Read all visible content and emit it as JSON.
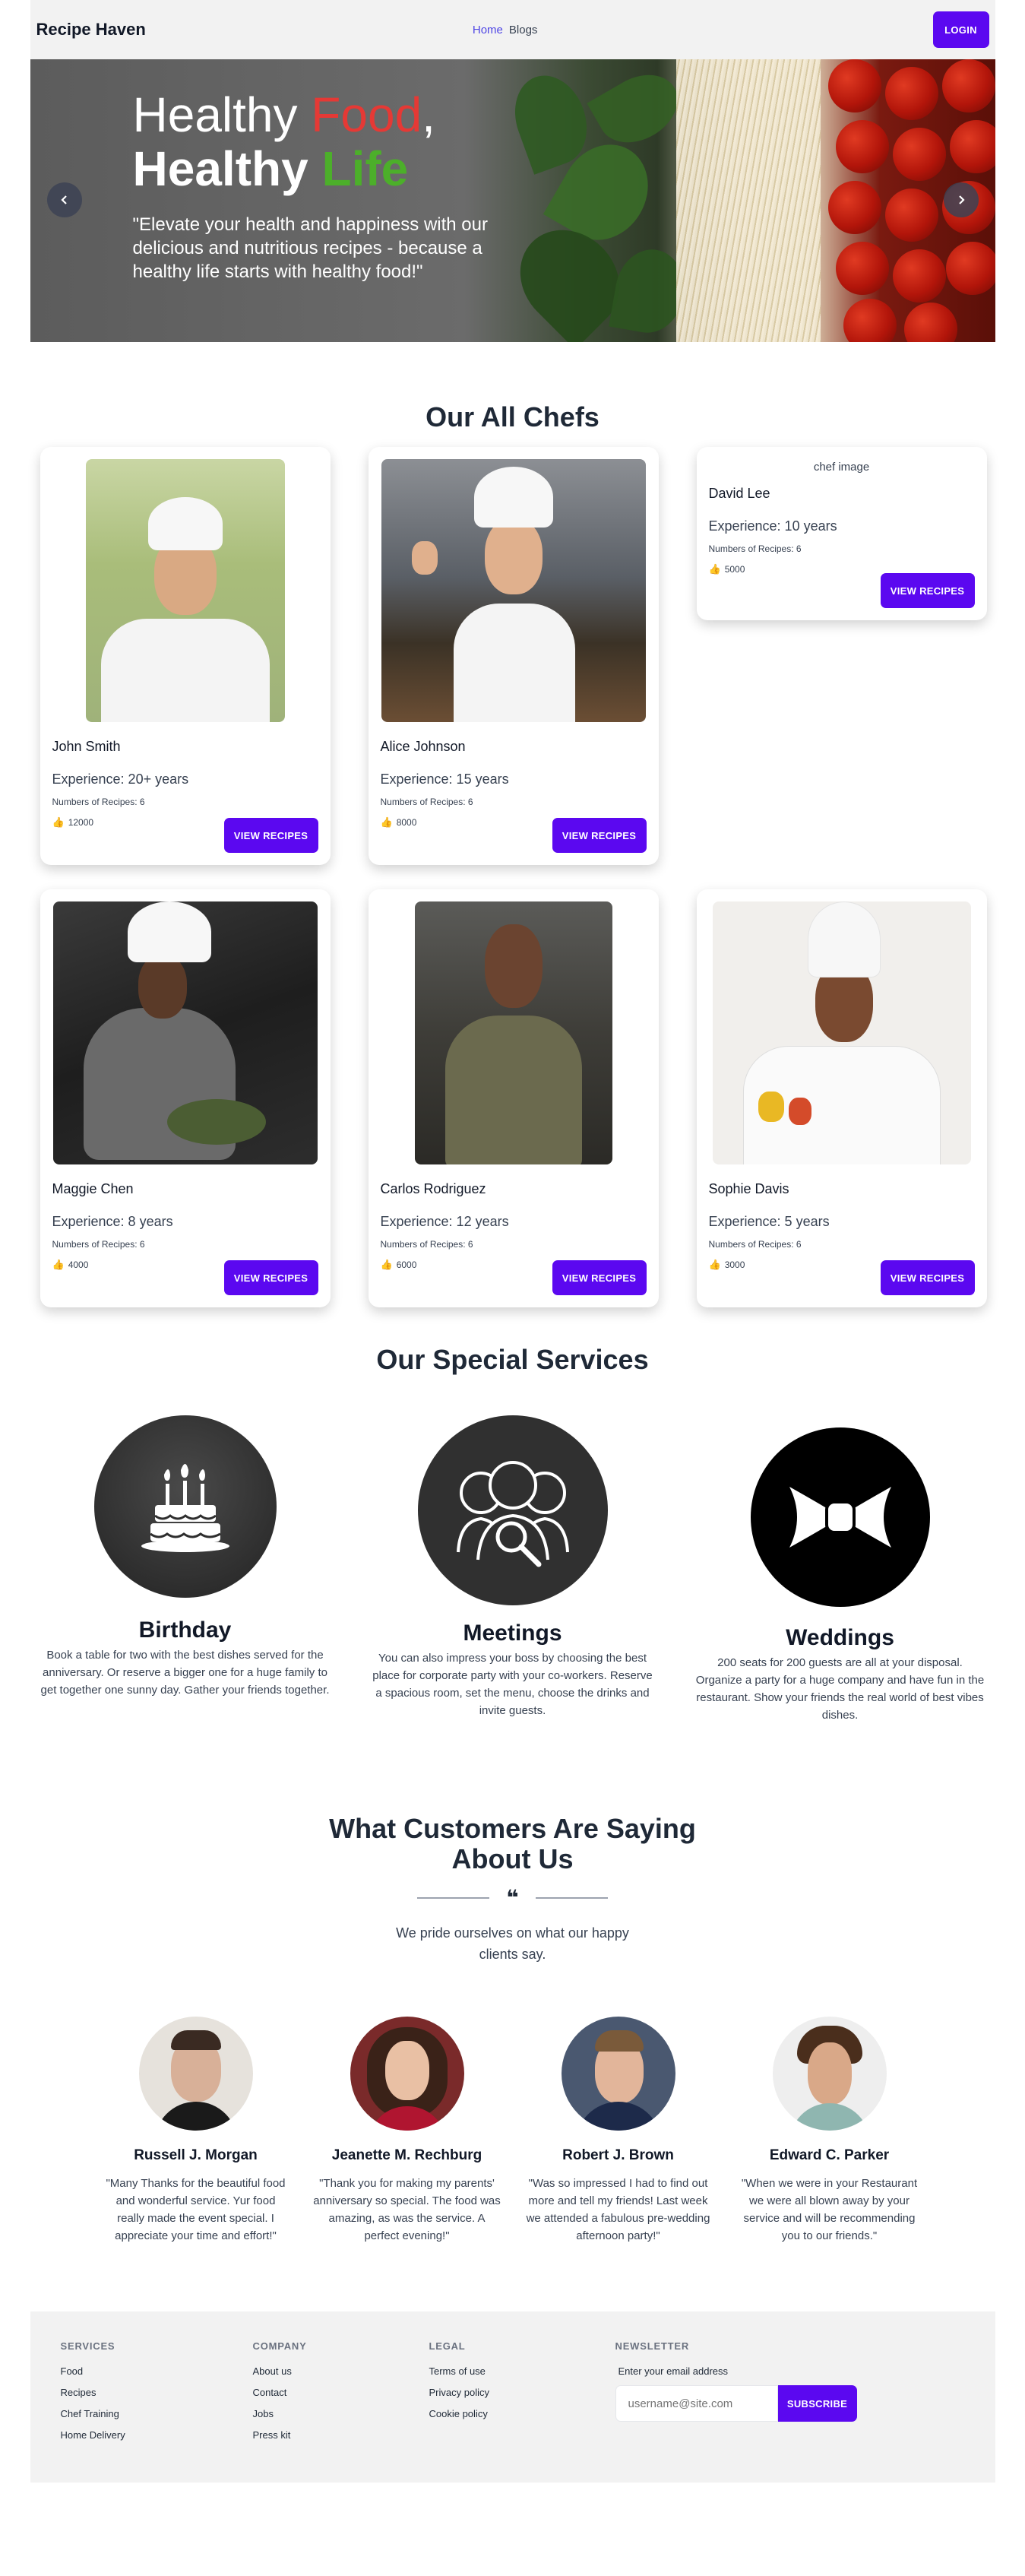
{
  "nav": {
    "brand": "Recipe Haven",
    "links": [
      "Home",
      "Blogs"
    ],
    "login": "LOGIN"
  },
  "hero": {
    "line1_a": "Healthy ",
    "line1_b": "Food",
    "line1_c": ",",
    "line2_a": "Healthy ",
    "line2_b": "Life",
    "quote": "\"Elevate your health and happiness with our delicious and nutritious recipes - because a healthy life starts with healthy food!\"",
    "prev_icon": "chevron-left-icon",
    "next_icon": "chevron-right-icon"
  },
  "chefs": {
    "title": "Our All Chefs",
    "view_label": "VIEW RECIPES",
    "broken_alt": "chef image",
    "items": [
      {
        "name": "John Smith",
        "experience": "Experience: 20+ years",
        "recipes": "Numbers of Recipes: 6",
        "likes": "12000"
      },
      {
        "name": "Alice Johnson",
        "experience": "Experience: 15 years",
        "recipes": "Numbers of Recipes: 6",
        "likes": "8000"
      },
      {
        "name": "David Lee",
        "experience": "Experience: 10 years",
        "recipes": "Numbers of Recipes: 6",
        "likes": "5000"
      },
      {
        "name": "Maggie Chen",
        "experience": "Experience: 8 years",
        "recipes": "Numbers of Recipes: 6",
        "likes": "4000"
      },
      {
        "name": "Carlos Rodriguez",
        "experience": "Experience: 12 years",
        "recipes": "Numbers of Recipes: 6",
        "likes": "6000"
      },
      {
        "name": "Sophie Davis",
        "experience": "Experience: 5 years",
        "recipes": "Numbers of Recipes: 6",
        "likes": "3000"
      }
    ]
  },
  "services": {
    "title": "Our Special Services",
    "items": [
      {
        "name": "Birthday",
        "desc": "Book a table for two with the best dishes served for the anniversary. Or reserve a bigger one for a huge family to get together one sunny day. Gather your friends together.",
        "icon": "birthday-cake-icon"
      },
      {
        "name": "Meetings",
        "desc": "You can also impress your boss by choosing the best place for corporate party with your co-workers. Reserve a spacious room, set the menu, choose the drinks and invite guests.",
        "icon": "meeting-people-icon"
      },
      {
        "name": "Weddings",
        "desc": "200 seats for 200 guests are all at your disposal. Organize a party for a huge company and have fun in the restaurant. Show your friends the real world of best vibes dishes.",
        "icon": "bow-tie-icon"
      }
    ]
  },
  "testimonials": {
    "title_line1": "What Customers Are Saying",
    "title_line2": "About Us",
    "quote_mark": "❝",
    "subtitle": "We pride ourselves on what our happy clients say.",
    "items": [
      {
        "name": "Russell J. Morgan",
        "text": "\"Many Thanks for the beautiful food and wonderful service. Yur food really made the event special. I appreciate your time and effort!\""
      },
      {
        "name": "Jeanette M. Rechburg",
        "text": "\"Thank you for making my parents' anniversary so special. The food was amazing, as was the service. A perfect evening!\""
      },
      {
        "name": "Robert J. Brown",
        "text": "\"Was so impressed I had to find out more and tell my friends! Last week we attended a fabulous pre-wedding afternoon party!\""
      },
      {
        "name": "Edward C. Parker",
        "text": "\"When we were in your Restaurant we were all blown away by your service and will be recommending you to our friends.\""
      }
    ]
  },
  "footer": {
    "services": {
      "title": "SERVICES",
      "links": [
        "Food",
        "Recipes",
        "Chef Training",
        "Home Delivery"
      ]
    },
    "company": {
      "title": "COMPANY",
      "links": [
        "About us",
        "Contact",
        "Jobs",
        "Press kit"
      ]
    },
    "legal": {
      "title": "LEGAL",
      "links": [
        "Terms of use",
        "Privacy policy",
        "Cookie policy"
      ]
    },
    "newsletter": {
      "title": "NEWSLETTER",
      "label": "Enter your email address",
      "placeholder": "username@site.com",
      "button": "SUBSCRIBE"
    }
  }
}
